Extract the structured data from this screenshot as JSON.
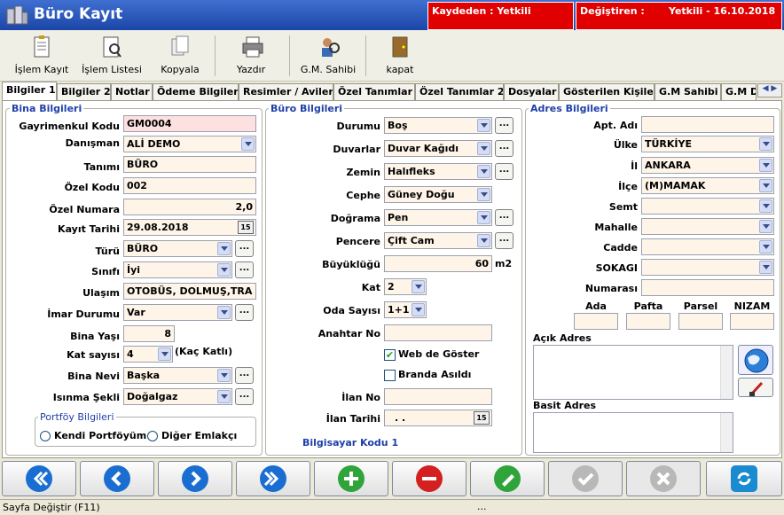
{
  "window": {
    "title": "Büro Kayıt"
  },
  "header": {
    "created_by_label": "Kaydeden : Yetkili",
    "modified_label": "Değiştiren :",
    "modified_value": "Yetkili - 16.10.2018"
  },
  "toolbar": {
    "islem_kayit": "İşlem Kayıt",
    "islem_listesi": "İşlem Listesi",
    "kopyala": "Kopyala",
    "yazdir": "Yazdır",
    "gm_sahibi": "G.M. Sahibi",
    "kapat": "kapat"
  },
  "tabs": [
    "Bilgiler 1",
    "Bilgiler 2",
    "Notlar",
    "Ödeme Bilgileri",
    "Resimler / Aviler",
    "Özel Tanımlar",
    "Özel Tanımlar 2",
    "Dosyalar",
    "Gösterilen Kişiler",
    "G.M Sahibi",
    "G.M D"
  ],
  "bina": {
    "section": "Bina Bilgileri",
    "gayrimenkul_kodu": {
      "label": "Gayrimenkul Kodu",
      "value": "GM0004"
    },
    "danisman": {
      "label": "Danışman",
      "value": "ALİ DEMO"
    },
    "tanimi": {
      "label": "Tanımı",
      "value": "BÜRO"
    },
    "ozel_kodu": {
      "label": "Özel Kodu",
      "value": "002"
    },
    "ozel_numara": {
      "label": "Özel Numara",
      "value": "2,0"
    },
    "kayit_tarihi": {
      "label": "Kayıt Tarihi",
      "value": "29.08.2018"
    },
    "turu": {
      "label": "Türü",
      "value": "BÜRO"
    },
    "sinifi": {
      "label": "Sınıfı",
      "value": "İyi"
    },
    "ulasim": {
      "label": "Ulaşım",
      "value": "OTOBÜS, DOLMUŞ,TRA"
    },
    "imar_durumu": {
      "label": "İmar Durumu",
      "value": "Var"
    },
    "bina_yasi": {
      "label": "Bina Yaşı",
      "value": "8"
    },
    "kat_sayisi": {
      "label": "Kat sayısı",
      "value": "4",
      "suffix": "(Kaç Katlı)"
    },
    "bina_nevi": {
      "label": "Bina Nevi",
      "value": "Başka"
    },
    "isinma_sekli": {
      "label": "Isınma Şekli",
      "value": "Doğalgaz"
    },
    "portfoy": {
      "section": "Portföy Bilgileri",
      "kendi": "Kendi Portföyüm",
      "diger": "Diğer Emlakçı"
    }
  },
  "buro": {
    "section": "Büro Bilgileri",
    "durumu": {
      "label": "Durumu",
      "value": "Boş"
    },
    "duvarlar": {
      "label": "Duvarlar",
      "value": "Duvar Kağıdı"
    },
    "zemin": {
      "label": "Zemin",
      "value": "Halıfleks"
    },
    "cephe": {
      "label": "Cephe",
      "value": "Güney Doğu"
    },
    "dograma": {
      "label": "Doğrama",
      "value": "Pen"
    },
    "pencere": {
      "label": "Pencere",
      "value": "Çift Cam"
    },
    "buyuklugu": {
      "label": "Büyüklüğü",
      "value": "60",
      "unit": "m2"
    },
    "kat": {
      "label": "Kat",
      "value": "2"
    },
    "oda_sayisi": {
      "label": "Oda Sayısı",
      "value": "1+1"
    },
    "anahtar_no": {
      "label": "Anahtar No",
      "value": ""
    },
    "web_de_goster": {
      "label": "Web de Göster",
      "checked": true
    },
    "branda_asildi": {
      "label": "Branda Asıldı",
      "checked": false
    },
    "ilan_no": {
      "label": "İlan No",
      "value": ""
    },
    "ilan_tarihi": {
      "label": "İlan Tarihi",
      "value": ". ."
    },
    "bilgisayar_kodu": "Bilgisayar Kodu 1"
  },
  "adres": {
    "section": "Adres Bilgileri",
    "apt_adi": {
      "label": "Apt. Adı",
      "value": ""
    },
    "ulke": {
      "label": "Ülke",
      "value": "TÜRKİYE"
    },
    "il": {
      "label": "İl",
      "value": "ANKARA"
    },
    "ilce": {
      "label": "İlçe",
      "value": "(M)MAMAK"
    },
    "semt": {
      "label": "Semt",
      "value": ""
    },
    "mahalle": {
      "label": "Mahalle",
      "value": ""
    },
    "cadde": {
      "label": "Cadde",
      "value": ""
    },
    "sokagi": {
      "label": "SOKAGI",
      "value": ""
    },
    "numarasi": {
      "label": "Numarası",
      "value": ""
    },
    "ada": "Ada",
    "pafta": "Pafta",
    "parsel": "Parsel",
    "nizam": "NIZAM",
    "acik_adres": "Açık Adres",
    "basit_adres": "Basit Adres"
  },
  "status": {
    "left": "Sayfa Değiştir (F11)",
    "mid": "..."
  },
  "icons": [
    "first-icon",
    "prev-icon",
    "next-icon",
    "last-icon",
    "add-icon",
    "delete-icon",
    "edit-icon",
    "save-icon",
    "cancel-icon",
    "refresh-icon"
  ]
}
